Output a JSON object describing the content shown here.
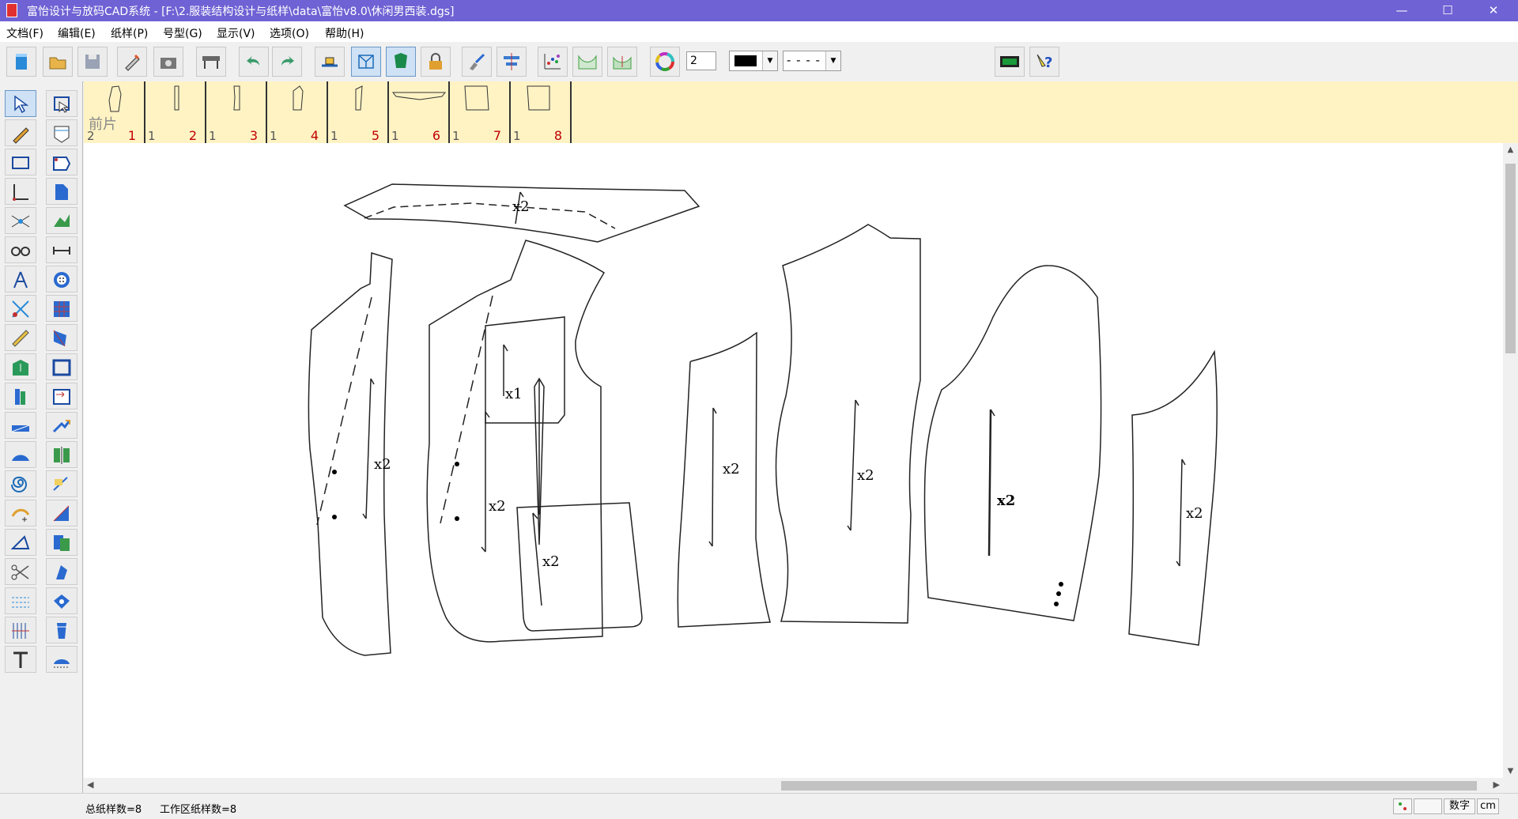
{
  "window": {
    "title": "富怡设计与放码CAD系统 - [F:\\2.服装结构设计与纸样\\data\\富怡v8.0\\休闲男西装.dgs]",
    "minimize": "—",
    "maximize": "☐",
    "close": "✕"
  },
  "menu": [
    "文档(F)",
    "编辑(E)",
    "纸样(P)",
    "号型(G)",
    "显示(V)",
    "选项(O)",
    "帮助(H)"
  ],
  "toolbar": {
    "line_width_value": "2",
    "color_swatch": "#000000",
    "line_style": "- - - -",
    "icons": [
      "new-file-icon",
      "open-folder-icon",
      "save-icon",
      "pencil-icon",
      "camera-icon",
      "plotter-icon",
      "undo-icon",
      "redo-icon",
      "grading-table-icon",
      "piece-view-icon",
      "fill-piece-icon",
      "lock-icon",
      "brush-icon",
      "align-icon",
      "scatter-points-icon",
      "fold-piece-icon",
      "unfold-piece-icon",
      "color-wheel-icon",
      "color-picker",
      "line-style-picker",
      "film-icon",
      "help-icon"
    ]
  },
  "left_tools": {
    "col1": [
      "select-arrow-icon",
      "pencil-draw-icon",
      "rectangle-icon",
      "corner-icon",
      "intersect-icon",
      "glasses-icon",
      "compass-icon",
      "cut-line-icon",
      "ruler-icon",
      "dart-icon",
      "pleat-icon",
      "strip-icon",
      "folded-piece-icon",
      "spiral-icon",
      "rotate-icon",
      "angle-icon",
      "scissors-icon",
      "hem-icon",
      "seam-icon",
      "text-icon"
    ],
    "col2": [
      "piece-select-icon",
      "pocket-icon",
      "blue-piece-icon",
      "notch-icon",
      "measure-icon",
      "button-icon",
      "grid-pattern-icon",
      "ruler-area-icon",
      "piece-frame-icon",
      "seam-allowance-icon",
      "flip-icon",
      "mirror-piece-icon",
      "corner-seam-icon",
      "piece-corner-icon",
      "split-piece-icon",
      "copy-piece-icon",
      "rotate-piece-icon",
      "piece-info-icon",
      "marker-icon"
    ]
  },
  "pieces": [
    {
      "name": "前片",
      "qty": "2",
      "num": "1"
    },
    {
      "qty": "1",
      "num": "2"
    },
    {
      "qty": "1",
      "num": "3"
    },
    {
      "qty": "1",
      "num": "4"
    },
    {
      "qty": "1",
      "num": "5"
    },
    {
      "qty": "1",
      "num": "6"
    },
    {
      "qty": "1",
      "num": "7"
    },
    {
      "qty": "1",
      "num": "8"
    }
  ],
  "canvas_labels": {
    "collar": "x2",
    "front_left": "x2",
    "front_right": "x2",
    "chest_pocket": "x1",
    "lower_pocket": "x2",
    "side_panel": "x2",
    "back": "x2",
    "top_sleeve": "x2",
    "under_sleeve": "x2"
  },
  "status": {
    "total": "总纸样数=8",
    "workspace": "工作区纸样数=8",
    "mode": "数字",
    "unit": "cm"
  }
}
